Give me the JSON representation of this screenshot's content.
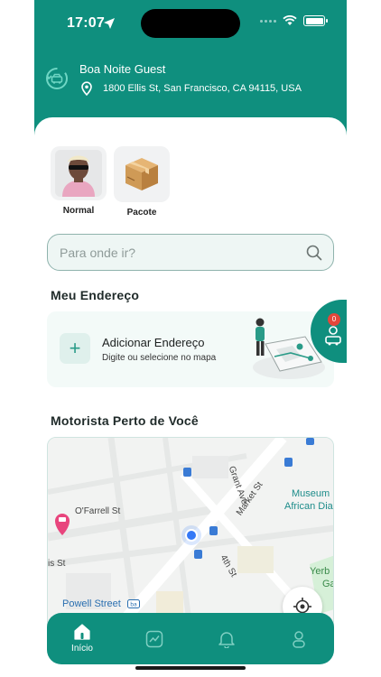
{
  "status": {
    "time": "17:07"
  },
  "header": {
    "greeting": "Boa Noite Guest",
    "address": "1800 Ellis St, San Francisco, CA 94115, USA"
  },
  "services": [
    {
      "label": "Normal"
    },
    {
      "label": "Pacote"
    }
  ],
  "search": {
    "placeholder": "Para onde ir?"
  },
  "my_address": {
    "title": "Meu Endereço",
    "card_title": "Adicionar Endereço",
    "card_subtitle": "Digite ou selecione no mapa",
    "notification_count": "0"
  },
  "nearby": {
    "title": "Motorista Perto de Você",
    "map_labels": {
      "street1": "O'Farrell St",
      "street2": "Grant Ave",
      "street3": "Market St",
      "street4": "4th St",
      "street5": "is St",
      "museum1": "Museum",
      "museum2": "African Dia",
      "yerba1": "Yerb",
      "yerba2": "Ga",
      "station": "Powell Street"
    }
  },
  "tabbar": {
    "home_label": "Início"
  },
  "colors": {
    "primary": "#0f8f7e",
    "accent_red": "#e3463a",
    "user_dot": "#3478f6"
  }
}
